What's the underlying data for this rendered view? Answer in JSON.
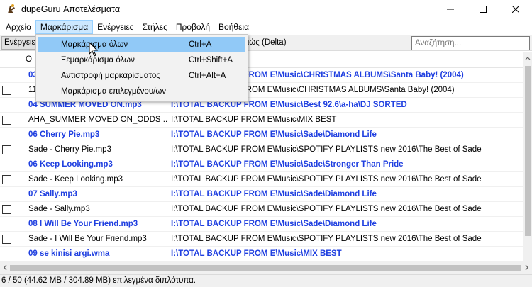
{
  "window": {
    "title": "dupeGuru Αποτελέσματα"
  },
  "menubar": [
    "Αρχείο",
    "Μαρκάρισμα",
    "Ενέργειες",
    "Στήλες",
    "Προβολή",
    "Βοήθεια"
  ],
  "toolbar": {
    "actions_label": "Ενέργειες",
    "delta_label": "λιώς (Delta)",
    "search_placeholder": "Αναζήτηση..."
  },
  "table": {
    "header_first": "Ο",
    "rows": [
      {
        "ref": true,
        "name": "03",
        "path": "I:\\TOTAL BACKUP FROM E\\Music\\CHRISTMAS ALBUMS\\Santa Baby! (2004)"
      },
      {
        "ref": false,
        "name": "11",
        "path": "I:\\TOTAL BACKUP FROM E\\Music\\CHRISTMAS ALBUMS\\Santa Baby! (2004)"
      },
      {
        "ref": true,
        "name": "04 SUMMER MOVED ON.mp3",
        "path": "I:\\TOTAL BACKUP FROM E\\Music\\Best 92.6\\a-ha\\DJ SORTED"
      },
      {
        "ref": false,
        "name": "AHA_SUMMER MOVED ON_ODDS ...",
        "path": "I:\\TOTAL BACKUP FROM E\\Music\\MIX BEST"
      },
      {
        "ref": true,
        "name": "06 Cherry Pie.mp3",
        "path": "I:\\TOTAL BACKUP FROM E\\Music\\Sade\\Diamond Life"
      },
      {
        "ref": false,
        "name": "Sade - Cherry Pie.mp3",
        "path": "I:\\TOTAL BACKUP FROM E\\Music\\SPOTIFY PLAYLISTS new 2016\\The Best of Sade"
      },
      {
        "ref": true,
        "name": "06 Keep Looking.mp3",
        "path": "I:\\TOTAL BACKUP FROM E\\Music\\Sade\\Stronger Than Pride"
      },
      {
        "ref": false,
        "name": "Sade - Keep Looking.mp3",
        "path": "I:\\TOTAL BACKUP FROM E\\Music\\SPOTIFY PLAYLISTS new 2016\\The Best of Sade"
      },
      {
        "ref": true,
        "name": "07 Sally.mp3",
        "path": "I:\\TOTAL BACKUP FROM E\\Music\\Sade\\Diamond Life"
      },
      {
        "ref": false,
        "name": "Sade - Sally.mp3",
        "path": "I:\\TOTAL BACKUP FROM E\\Music\\SPOTIFY PLAYLISTS new 2016\\The Best of Sade"
      },
      {
        "ref": true,
        "name": "08 I Will Be Your Friend.mp3",
        "path": "I:\\TOTAL BACKUP FROM E\\Music\\Sade\\Diamond Life"
      },
      {
        "ref": false,
        "name": "Sade - I Will Be Your Friend.mp3",
        "path": "I:\\TOTAL BACKUP FROM E\\Music\\SPOTIFY PLAYLISTS new 2016\\The Best of Sade"
      },
      {
        "ref": true,
        "name": "09 se kinisi argi.wma",
        "path": "I:\\TOTAL BACKUP FROM E\\Music\\MIX BEST"
      }
    ]
  },
  "dropdown": [
    {
      "label": "Μαρκάρισμα όλων",
      "shortcut": "Ctrl+A",
      "hover": true
    },
    {
      "label": "Ξεμαρκάρισμα όλων",
      "shortcut": "Ctrl+Shift+A",
      "hover": false
    },
    {
      "label": "Αντιστροφή μαρκαρίσματος",
      "shortcut": "Ctrl+Alt+A",
      "hover": false
    },
    {
      "label": "Μαρκάρισμα επιλεγμένου/ων",
      "shortcut": "",
      "hover": false
    }
  ],
  "statusbar": {
    "text": "6 / 50 (44.62 MB / 304.89 MB) επιλεγμένα διπλότυπα."
  },
  "colors": {
    "reference_text": "#1f3fe0",
    "menu_active": "#cce8ff",
    "dropdown_hover": "#91c9f7"
  }
}
